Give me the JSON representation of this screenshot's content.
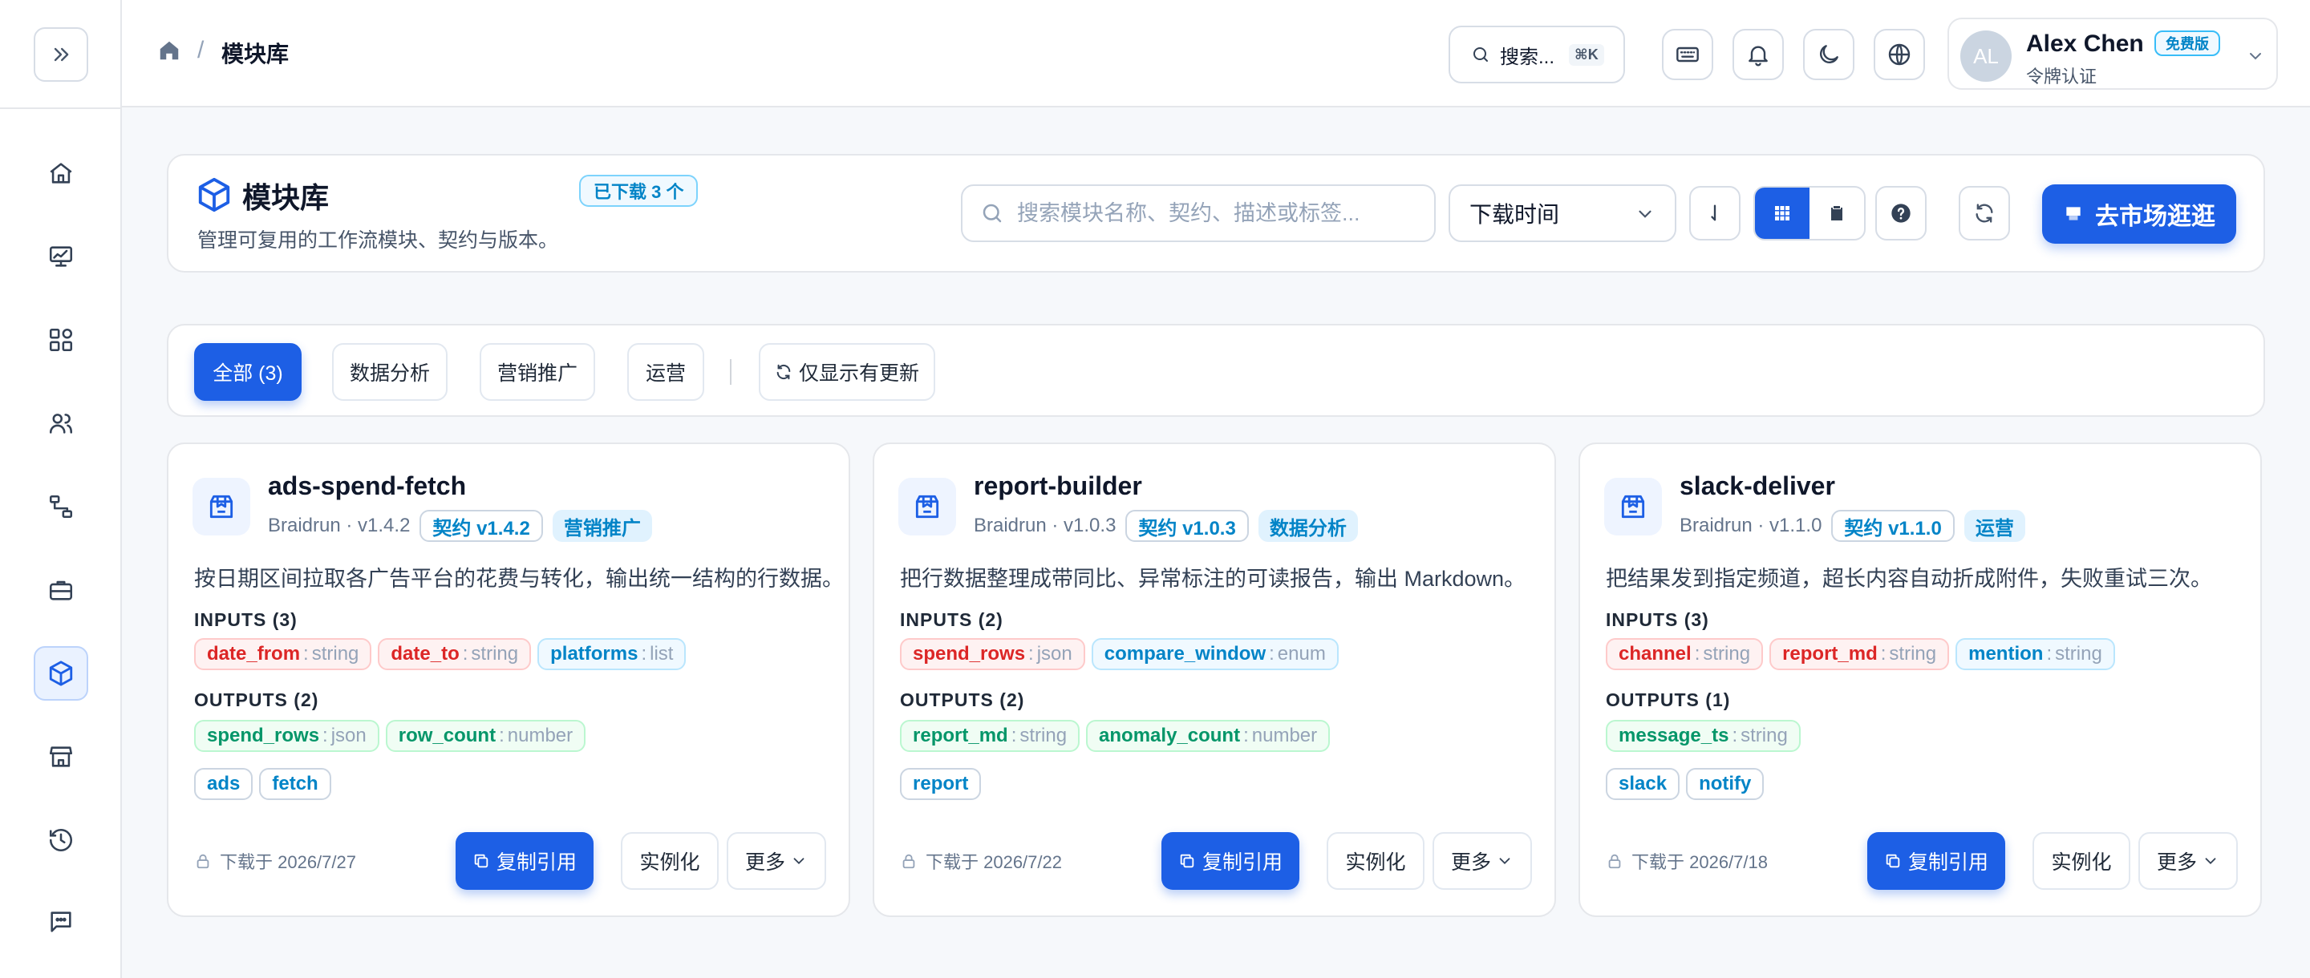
{
  "breadcrumb": {
    "current": "模块库"
  },
  "topbar": {
    "search_label": "搜索...",
    "search_shortcut": "⌘K"
  },
  "user": {
    "initials": "AL",
    "name": "Alex Chen",
    "plan": "免费版",
    "auth": "令牌认证"
  },
  "page": {
    "title": "模块库",
    "description": "管理可复用的工作流模块、契约与版本。",
    "downloaded_badge": "已下载 3 个",
    "search_placeholder": "搜索模块名称、契约、描述或标签...",
    "sort_value": "下载时间",
    "market_button": "去市场逛逛"
  },
  "filters": [
    {
      "label": "全部 (3)",
      "active": true
    },
    {
      "label": "数据分析",
      "active": false
    },
    {
      "label": "营销推广",
      "active": false
    },
    {
      "label": "运营",
      "active": false
    }
  ],
  "filter_updates_only": "仅显示有更新",
  "labels": {
    "copy": "复制引用",
    "instantiate": "实例化",
    "more": "更多"
  },
  "modules": [
    {
      "name": "ads-spend-fetch",
      "meta": "Braidrun · v1.4.2",
      "contract": "契约 v1.4.2",
      "category": "营销推广",
      "description": "按日期区间拉取各广告平台的花费与转化，输出统一结构的行数据。",
      "inputs_label": "INPUTS (3)",
      "inputs": [
        {
          "name": "date_from",
          "type": "string"
        },
        {
          "name": "date_to",
          "type": "string"
        },
        {
          "name": "platforms",
          "type": "list"
        }
      ],
      "outputs_label": "OUTPUTS (2)",
      "outputs": [
        {
          "name": "spend_rows",
          "type": "json"
        },
        {
          "name": "row_count",
          "type": "number"
        }
      ],
      "tags": [
        "ads",
        "fetch"
      ],
      "downloaded": "下载于 2026/7/27"
    },
    {
      "name": "report-builder",
      "meta": "Braidrun · v1.0.3",
      "contract": "契约 v1.0.3",
      "category": "数据分析",
      "description": "把行数据整理成带同比、异常标注的可读报告，输出 Markdown。",
      "inputs_label": "INPUTS (2)",
      "inputs": [
        {
          "name": "spend_rows",
          "type": "json"
        },
        {
          "name": "compare_window",
          "type": "enum"
        }
      ],
      "outputs_label": "OUTPUTS (2)",
      "outputs": [
        {
          "name": "report_md",
          "type": "string"
        },
        {
          "name": "anomaly_count",
          "type": "number"
        }
      ],
      "tags": [
        "report"
      ],
      "downloaded": "下载于 2026/7/22"
    },
    {
      "name": "slack-deliver",
      "meta": "Braidrun · v1.1.0",
      "contract": "契约 v1.1.0",
      "category": "运营",
      "description": "把结果发到指定频道，超长内容自动折成附件，失败重试三次。",
      "inputs_label": "INPUTS (3)",
      "inputs": [
        {
          "name": "channel",
          "type": "string"
        },
        {
          "name": "report_md",
          "type": "string"
        },
        {
          "name": "mention",
          "type": "string"
        }
      ],
      "outputs_label": "OUTPUTS (1)",
      "outputs": [
        {
          "name": "message_ts",
          "type": "string"
        }
      ],
      "tags": [
        "slack",
        "notify"
      ],
      "downloaded": "下载于 2026/7/18"
    }
  ],
  "colors": {
    "primary": "#1d5fe5",
    "input_red": "#dc2626",
    "input_blue": "#0284c7",
    "output_green": "#059669"
  }
}
